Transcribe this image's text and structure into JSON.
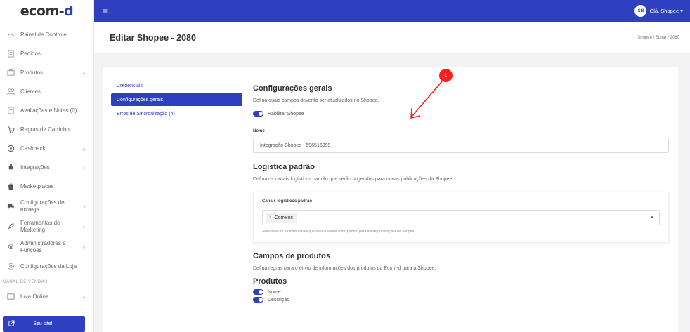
{
  "logo": {
    "text_main": "ecom-",
    "text_accent": "d"
  },
  "sidebar": {
    "items": [
      {
        "label": "Painel de Controle",
        "icon": "dashboard-gauge-icon",
        "chevron": false
      },
      {
        "label": "Pedidos",
        "icon": "orders-icon",
        "chevron": false
      },
      {
        "label": "Produtos",
        "icon": "products-icon",
        "chevron": true
      },
      {
        "label": "Clientes",
        "icon": "clients-icon",
        "chevron": false
      },
      {
        "label": "Avaliações e Notas (0)",
        "icon": "reviews-icon",
        "chevron": false
      },
      {
        "label": "Regras de Carrinho",
        "icon": "cart-icon",
        "chevron": false
      },
      {
        "label": "Cashback",
        "icon": "cashback-icon",
        "chevron": true
      },
      {
        "label": "Integrações",
        "icon": "integrations-icon",
        "chevron": true
      },
      {
        "label": "Marketplaces",
        "icon": "marketplace-icon",
        "chevron": false
      },
      {
        "label": "Configurações de entrega",
        "icon": "truck-icon",
        "chevron": true
      },
      {
        "label": "Ferramentas de Marketing",
        "icon": "rocket-icon",
        "chevron": true
      },
      {
        "label": "Administradores e Funções",
        "icon": "admin-gear-icon",
        "chevron": true
      },
      {
        "label": "Configurações da Loja",
        "icon": "settings-gear-icon",
        "chevron": false
      }
    ],
    "section_label": "CANAL DE VENDAS",
    "store_item": {
      "label": "Loja Online",
      "icon": "store-icon"
    },
    "site_button": "Seu site!",
    "chevron_glyph": "›"
  },
  "topbar": {
    "menu_glyph": "≡",
    "avatar_initials": "SH",
    "user_label": "Olá, Shopee ▾"
  },
  "header": {
    "title": "Editar Shopee - 2080",
    "breadcrumb": "Shopee  /  Editar  /  2080"
  },
  "tabs": [
    {
      "label": "Credenciais",
      "active": false
    },
    {
      "label": "Configurações gerais",
      "active": true
    },
    {
      "label": "Erros de Sincronização (4)",
      "active": false
    }
  ],
  "general": {
    "title": "Configurações gerais",
    "description": "Defina quais campos deverão ser atualizados no Shopee.",
    "toggle_label": "Habilitar Shopee",
    "name_label": "Nome",
    "name_value": "Integração Shopee - 596516999"
  },
  "logistics": {
    "title": "Logística padrão",
    "description": "Defina os canais logísticos padrão que serão sugeridos para novas publicações da Shopee.",
    "field_label": "Canais logísticos padrão",
    "chip": "Correios",
    "chip_remove": "×",
    "clear": "×",
    "hint": "Selecione um ou mais canais que serão usados como padrão para novas publicações da Shopee."
  },
  "products": {
    "title": "Campos de produtos",
    "description": "Defina regras para o envio de informações dos produtos da Ecom-d para a Shopee.",
    "subtitle": "Produtos",
    "toggles": [
      "Nome",
      "Descrição"
    ]
  },
  "annotation": {
    "badge": "1",
    "color": "#ff1e1e"
  },
  "colors": {
    "primary": "#2e3fbf",
    "background": "#f3f3f6"
  }
}
